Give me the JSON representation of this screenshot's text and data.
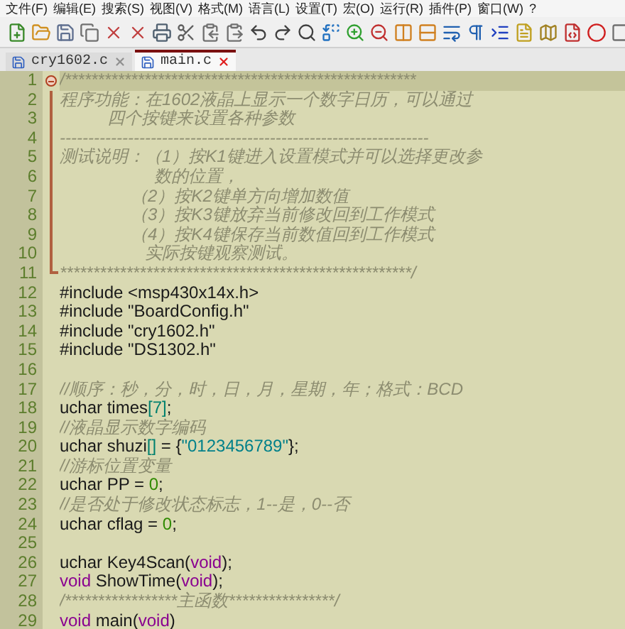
{
  "menu": [
    "文件(F)",
    "编辑(E)",
    "搜索(S)",
    "视图(V)",
    "格式(M)",
    "语言(L)",
    "设置(T)",
    "宏(O)",
    "运行(R)",
    "插件(P)",
    "窗口(W)",
    "?"
  ],
  "tabs": [
    {
      "label": "cry1602.c",
      "selected": false
    },
    {
      "label": "main.c",
      "selected": true
    }
  ],
  "lines": [
    {
      "number": "1",
      "current": true,
      "kind": "fold_start",
      "tokens": [
        {
          "kind": "comment",
          "text": "/*****************************************************"
        }
      ]
    },
    {
      "number": "2",
      "current": false,
      "kind": "fold_body",
      "tokens": [
        {
          "kind": "comment",
          "text": "程序功能：在1602液晶上显示一个数字日历，可以通过"
        }
      ]
    },
    {
      "number": "3",
      "current": false,
      "kind": "fold_body",
      "tokens": [
        {
          "kind": "comment",
          "text": "          四个按键来设置各种参数"
        }
      ]
    },
    {
      "number": "4",
      "current": false,
      "kind": "fold_body",
      "tokens": [
        {
          "kind": "comment",
          "text": "-----------------------------------------------------------------"
        }
      ]
    },
    {
      "number": "5",
      "current": false,
      "kind": "fold_body",
      "tokens": [
        {
          "kind": "comment",
          "text": "测试说明：（1）按K1键进入设置模式并可以选择更改参"
        }
      ]
    },
    {
      "number": "6",
      "current": false,
      "kind": "fold_body",
      "tokens": [
        {
          "kind": "comment",
          "text": "                    数的位置，"
        }
      ]
    },
    {
      "number": "7",
      "current": false,
      "kind": "fold_body",
      "tokens": [
        {
          "kind": "comment",
          "text": "               （2）按K2键单方向增加数值"
        }
      ]
    },
    {
      "number": "8",
      "current": false,
      "kind": "fold_body",
      "tokens": [
        {
          "kind": "comment",
          "text": "               （3）按K3键放弃当前修改回到工作模式"
        }
      ]
    },
    {
      "number": "9",
      "current": false,
      "kind": "fold_body",
      "tokens": [
        {
          "kind": "comment",
          "text": "               （4）按K4键保存当前数值回到工作模式"
        }
      ]
    },
    {
      "number": "10",
      "current": false,
      "kind": "fold_body",
      "tokens": [
        {
          "kind": "comment",
          "text": "                  实际按键观察测试。"
        }
      ]
    },
    {
      "number": "11",
      "current": false,
      "kind": "fold_end",
      "tokens": [
        {
          "kind": "comment",
          "text": "*****************************************************/"
        }
      ]
    },
    {
      "number": "12",
      "current": false,
      "kind": "plain",
      "tokens": [
        {
          "kind": "plain",
          "text": "#include <msp430x14x.h>"
        }
      ]
    },
    {
      "number": "13",
      "current": false,
      "kind": "plain",
      "tokens": [
        {
          "kind": "plain",
          "text": "#include \"BoardConfig.h\""
        }
      ]
    },
    {
      "number": "14",
      "current": false,
      "kind": "plain",
      "tokens": [
        {
          "kind": "plain",
          "text": "#include \"cry1602.h\""
        }
      ]
    },
    {
      "number": "15",
      "current": false,
      "kind": "plain",
      "tokens": [
        {
          "kind": "plain",
          "text": "#include \"DS1302.h\""
        }
      ]
    },
    {
      "number": "16",
      "current": false,
      "kind": "plain"
    },
    {
      "number": "17",
      "current": false,
      "kind": "plain",
      "tokens": [
        {
          "kind": "comment",
          "text": "//顺序：秒，分，时，日，月，星期，年；格式：BCD"
        }
      ]
    },
    {
      "number": "18",
      "current": false,
      "kind": "plain",
      "tokens": [
        {
          "kind": "plain",
          "text": "uchar times"
        },
        {
          "kind": "operator",
          "text": "[7]"
        },
        {
          "kind": "plain",
          "text": ";"
        }
      ]
    },
    {
      "number": "19",
      "current": false,
      "kind": "plain",
      "tokens": [
        {
          "kind": "comment",
          "text": "//液晶显示数字编码"
        }
      ]
    },
    {
      "number": "20",
      "current": false,
      "kind": "plain",
      "tokens": [
        {
          "kind": "plain",
          "text": "uchar shuzi"
        },
        {
          "kind": "operator",
          "text": "[]"
        },
        {
          "kind": "plain",
          "text": " = {"
        },
        {
          "kind": "string",
          "text": "\"0123456789\""
        },
        {
          "kind": "plain",
          "text": "};"
        }
      ]
    },
    {
      "number": "21",
      "current": false,
      "kind": "plain",
      "tokens": [
        {
          "kind": "comment",
          "text": "//游标位置变量"
        }
      ]
    },
    {
      "number": "22",
      "current": false,
      "kind": "plain",
      "tokens": [
        {
          "kind": "plain",
          "text": "uchar PP = "
        },
        {
          "kind": "number",
          "text": "0"
        },
        {
          "kind": "plain",
          "text": ";"
        }
      ]
    },
    {
      "number": "23",
      "current": false,
      "kind": "plain",
      "tokens": [
        {
          "kind": "comment",
          "text": "//是否处于修改状态标志，1--是，0--否"
        }
      ]
    },
    {
      "number": "24",
      "current": false,
      "kind": "plain",
      "tokens": [
        {
          "kind": "plain",
          "text": "uchar cflag = "
        },
        {
          "kind": "number",
          "text": "0"
        },
        {
          "kind": "plain",
          "text": ";"
        }
      ]
    },
    {
      "number": "25",
      "current": false,
      "kind": "plain"
    },
    {
      "number": "26",
      "current": false,
      "kind": "plain",
      "tokens": [
        {
          "kind": "plain",
          "text": "uchar Key4Scan("
        },
        {
          "kind": "keyword",
          "text": "void"
        },
        {
          "kind": "plain",
          "text": ");"
        }
      ]
    },
    {
      "number": "27",
      "current": false,
      "kind": "plain",
      "tokens": [
        {
          "kind": "keyword",
          "text": "void"
        },
        {
          "kind": "plain",
          "text": " ShowTime("
        },
        {
          "kind": "keyword",
          "text": "void"
        },
        {
          "kind": "plain",
          "text": ");"
        }
      ]
    },
    {
      "number": "28",
      "current": false,
      "kind": "plain",
      "tokens": [
        {
          "kind": "comment",
          "text": "/*****************主函数****************/"
        }
      ]
    },
    {
      "number": "29",
      "current": false,
      "kind": "plain",
      "tokens": [
        {
          "kind": "keyword",
          "text": "void"
        },
        {
          "kind": "plain",
          "text": " main("
        },
        {
          "kind": "keyword",
          "text": "void"
        },
        {
          "kind": "plain",
          "text": ")"
        }
      ]
    }
  ]
}
